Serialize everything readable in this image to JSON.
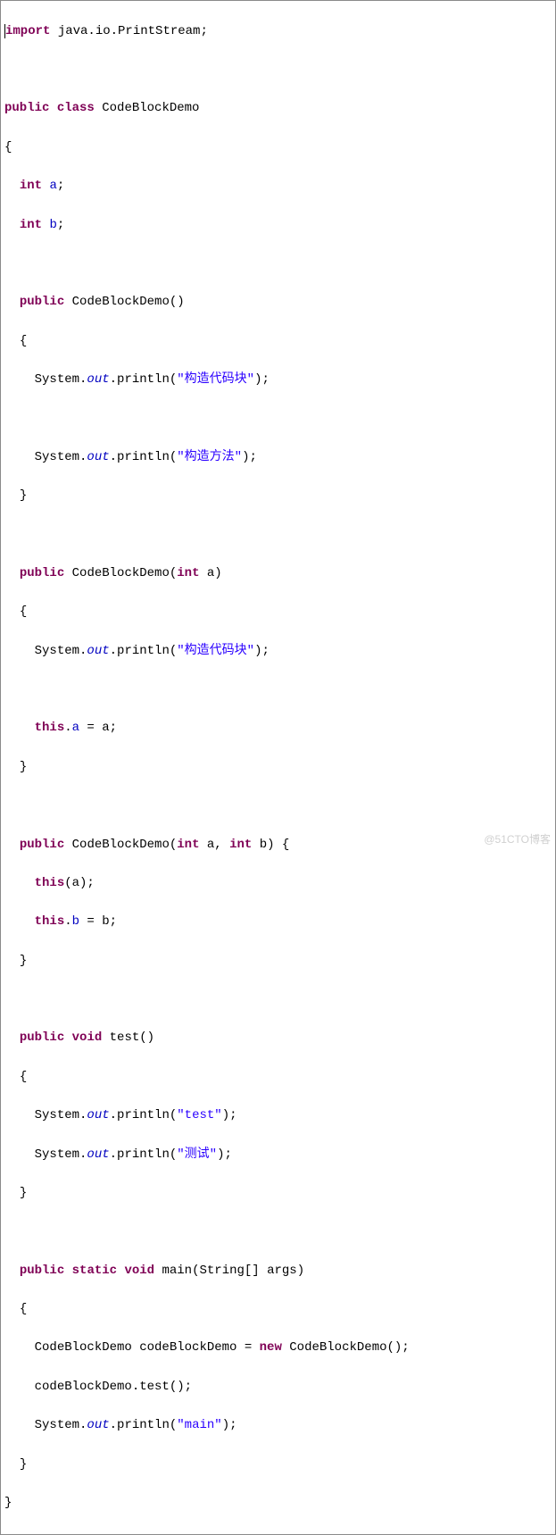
{
  "code": {
    "kw_import": "import",
    "imp_pkg": " java.io.PrintStream;",
    "kw_public": "public",
    "kw_class": "class",
    "classname": " CodeBlockDemo",
    "lbrace": "{",
    "rbrace": "}",
    "indent1": "  ",
    "indent2": "    ",
    "kw_int": "int",
    "sp": " ",
    "fld_a": "a",
    "fld_b": "b",
    "semi": ";",
    "ctor0_sig": " CodeBlockDemo()",
    "sys": "System.",
    "out": "out",
    "println_open": ".println(",
    "s_ctor_block": "\"构造代码块\"",
    "s_ctor_method": "\"构造方法\"",
    "close_stmt": ");",
    "ctor1_sig_pre": " CodeBlockDemo(",
    "ctor1_params": " a)",
    "kw_this": "this",
    "this_a_assign": " = a;",
    "dot_a": ".",
    "ctor2_params_a": " a, ",
    "ctor2_params_b": " b) {",
    "this_call": "(a);",
    "this_b_assign": " = b;",
    "dot_b": ".",
    "kw_void": "void",
    "test_sig": " test()",
    "s_test": "\"test\"",
    "s_test_cn": "\"测试\"",
    "kw_static": "static",
    "main_sig": " main(String[] args)",
    "decl_pre": "CodeBlockDemo codeBlockDemo = ",
    "kw_new": "new",
    "new_call": " CodeBlockDemo();",
    "call_test": "codeBlockDemo.test();",
    "s_main": "\"main\""
  },
  "watermark": "@51CTO博客"
}
